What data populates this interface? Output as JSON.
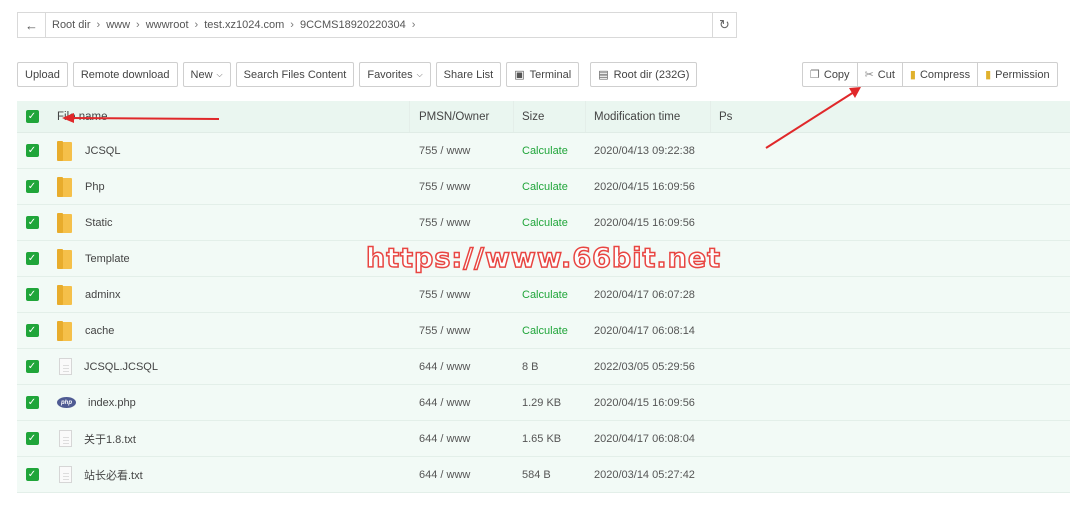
{
  "path": {
    "back_icon": "arrow-left-icon",
    "crumbs": [
      "Root dir",
      "www",
      "wwwroot",
      "test.xz1024.com",
      "9CCMS18920220304"
    ],
    "separator": "›",
    "refresh_icon": "refresh-icon"
  },
  "toolbar": {
    "upload": "Upload",
    "remote_download": "Remote download",
    "new": "New",
    "search_files_content": "Search Files Content",
    "favorites": "Favorites",
    "share_list": "Share List",
    "terminal": "Terminal",
    "root_dir": "Root dir (232G)"
  },
  "batch": {
    "copy": "Copy",
    "cut": "Cut",
    "compress": "Compress",
    "permission": "Permission"
  },
  "table": {
    "headers": {
      "name": "File name",
      "perm": "PMSN/Owner",
      "size": "Size",
      "modified": "Modification time",
      "ps": "Ps"
    },
    "rows": [
      {
        "type": "folder",
        "name": "JCSQL",
        "perm": "755 / www",
        "size": "Calculate",
        "modified": "2020/04/13 09:22:38"
      },
      {
        "type": "folder",
        "name": "Php",
        "perm": "755 / www",
        "size": "Calculate",
        "modified": "2020/04/15 16:09:56"
      },
      {
        "type": "folder",
        "name": "Static",
        "perm": "755 / www",
        "size": "Calculate",
        "modified": "2020/04/15 16:09:56"
      },
      {
        "type": "folder",
        "name": "Template",
        "perm": "",
        "size": "",
        "modified": ""
      },
      {
        "type": "folder",
        "name": "adminx",
        "perm": "755 / www",
        "size": "Calculate",
        "modified": "2020/04/17 06:07:28"
      },
      {
        "type": "folder",
        "name": "cache",
        "perm": "755 / www",
        "size": "Calculate",
        "modified": "2020/04/17 06:08:14"
      },
      {
        "type": "file",
        "name": "JCSQL.JCSQL",
        "perm": "644 / www",
        "size": "8 B",
        "modified": "2022/03/05 05:29:56"
      },
      {
        "type": "php",
        "name": "index.php",
        "perm": "644 / www",
        "size": "1.29 KB",
        "modified": "2020/04/15 16:09:56"
      },
      {
        "type": "file",
        "name": "关于1.8.txt",
        "perm": "644 / www",
        "size": "1.65 KB",
        "modified": "2020/04/17 06:08:04"
      },
      {
        "type": "file",
        "name": "站长必看.txt",
        "perm": "644 / www",
        "size": "584 B",
        "modified": "2020/03/14 05:27:42"
      }
    ]
  },
  "watermark": "https://www.66bit.net",
  "colors": {
    "accent": "#20a53a",
    "row_bg": "#f2faf6",
    "arrow": "#e0282a"
  }
}
